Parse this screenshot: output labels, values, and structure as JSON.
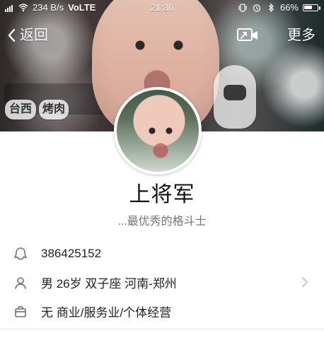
{
  "status_bar": {
    "signal_text": " ",
    "data_rate": "234 B/s",
    "network": "VoLTE",
    "time": "21:36",
    "battery_percent": "66%",
    "battery_level": 0.66,
    "icons": [
      "signal-bars-icon",
      "wifi-icon",
      "vibrate-icon",
      "alarm-icon",
      "bluetooth-icon",
      "battery-icon"
    ]
  },
  "nav": {
    "back_label": "返回",
    "more_label": "更多",
    "cast_icon": "screen-cast-icon"
  },
  "profile": {
    "name": "上将军",
    "bio": "...最优秀的格斗士"
  },
  "cover": {
    "chip1": "台西",
    "chip2": "烤肉"
  },
  "info_rows": [
    {
      "icon": "qq-penguin-icon",
      "text": "386425152",
      "has_chevron": false
    },
    {
      "icon": "user-icon",
      "text": "男  26岁  双子座  河南-郑州",
      "has_chevron": true
    },
    {
      "icon": "briefcase-icon",
      "text": "无  商业/服务业/个体经营",
      "has_chevron": false
    }
  ],
  "colors": {
    "accent": "#111111",
    "secondary_text": "#777777",
    "divider": "#e6e6e6"
  }
}
